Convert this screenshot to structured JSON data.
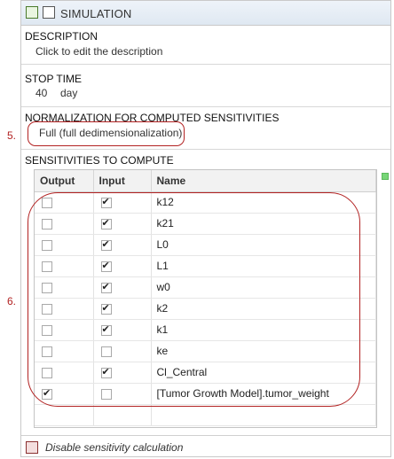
{
  "header": {
    "title": "SIMULATION",
    "icon1": "green-flag-icon",
    "icon2": "chart-icon"
  },
  "description": {
    "label": "DESCRIPTION",
    "value": "Click to edit the description"
  },
  "stop_time": {
    "label": "STOP TIME",
    "value": "40",
    "unit": "day"
  },
  "normalization": {
    "label": "NORMALIZATION FOR COMPUTED SENSITIVITIES",
    "value": "Full (full dedimensionalization)"
  },
  "sensitivities": {
    "label": "SENSITIVITIES TO COMPUTE",
    "columns": [
      "Output",
      "Input",
      "Name"
    ],
    "rows": [
      {
        "output": false,
        "input": true,
        "name": "k12"
      },
      {
        "output": false,
        "input": true,
        "name": "k21"
      },
      {
        "output": false,
        "input": true,
        "name": "L0"
      },
      {
        "output": false,
        "input": true,
        "name": "L1"
      },
      {
        "output": false,
        "input": true,
        "name": "w0"
      },
      {
        "output": false,
        "input": true,
        "name": "k2"
      },
      {
        "output": false,
        "input": true,
        "name": "k1"
      },
      {
        "output": false,
        "input": false,
        "name": "ke"
      },
      {
        "output": false,
        "input": true,
        "name": "Cl_Central"
      },
      {
        "output": true,
        "input": false,
        "name": "[Tumor Growth Model].tumor_weight"
      }
    ]
  },
  "footer": {
    "label": "Disable sensitivity calculation",
    "icon": "disable-sensitivity-icon"
  },
  "annotations": {
    "a5": "5.",
    "a6": "6."
  },
  "colors": {
    "annotation": "#b22222",
    "header_bg": "#e4ecf5",
    "status_dot": "#77d677"
  }
}
